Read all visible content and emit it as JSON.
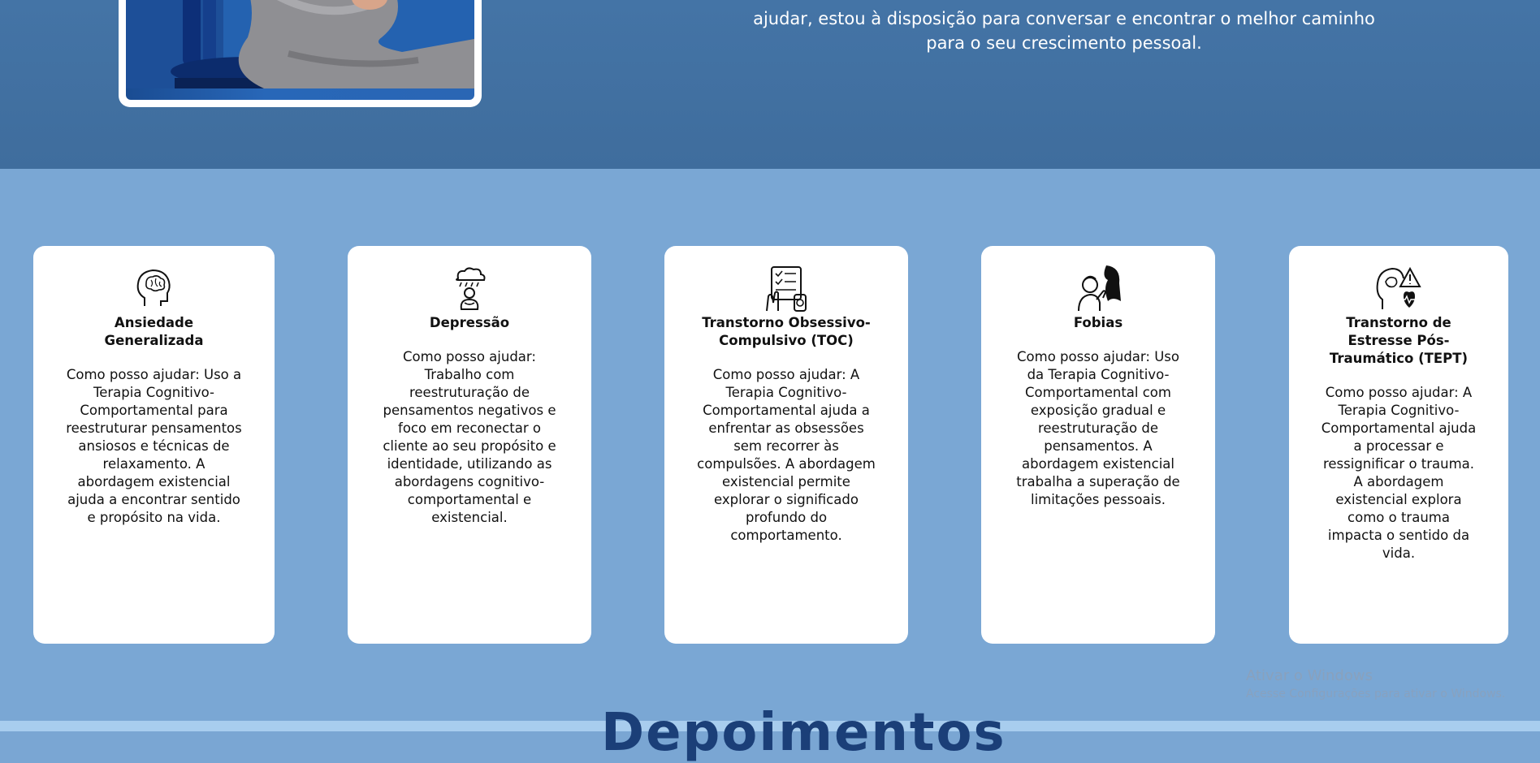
{
  "hero": {
    "text": "ajudar, estou à disposição para conversar e encontrar o melhor caminho para o seu crescimento pessoal."
  },
  "cards": [
    {
      "icon": "brain-head-icon",
      "title": "Ansiedade Generalizada",
      "body": "Como posso ajudar: Uso a Terapia Cognitivo-Comportamental para reestruturar pensamentos ansiosos e técnicas de relaxamento. A abordagem existencial ajuda a encontrar sentido e propósito na vida."
    },
    {
      "icon": "sad-person-rain-cloud-icon",
      "title": "Depressão",
      "body": "Como posso ajudar: Trabalho com reestruturação de pensamentos negativos e foco em reconectar o cliente ao seu propósito e identidade, utilizando as abordagens cognitivo-comportamental e existencial."
    },
    {
      "icon": "checklist-handwash-icon",
      "title": "Transtorno Obsessivo-Compulsivo (TOC)",
      "body": "Como posso ajudar: A Terapia Cognitivo-Comportamental ajuda a enfrentar as obsessões sem recorrer às compulsões. A abordagem existencial permite explorar o significado profundo do comportamento."
    },
    {
      "icon": "frightened-person-icon",
      "title": "Fobias",
      "body": "Como posso ajudar: Uso da Terapia Cognitivo-Comportamental com exposição gradual e reestruturação de pensamentos. A abordagem existencial trabalha a superação de limitações pessoais."
    },
    {
      "icon": "head-warning-heartbeat-icon",
      "title": "Transtorno de Estresse Pós-Traumático (TEPT)",
      "body": "Como posso ajudar: A Terapia Cognitivo-Comportamental ajuda a processar e ressignificar o trauma. A abordagem existencial explora como o trauma impacta o sentido da vida."
    }
  ],
  "watermark": {
    "title": "Ativar o Windows",
    "subtitle": "Acesse Configurações para ativar o Windows."
  },
  "next_section": {
    "title": "Depoimentos"
  },
  "colors": {
    "hero_bg": "#4474a6",
    "section_bg": "#7aa7d4",
    "card_bg": "#ffffff",
    "bottom_bar": "#a8cdee"
  }
}
